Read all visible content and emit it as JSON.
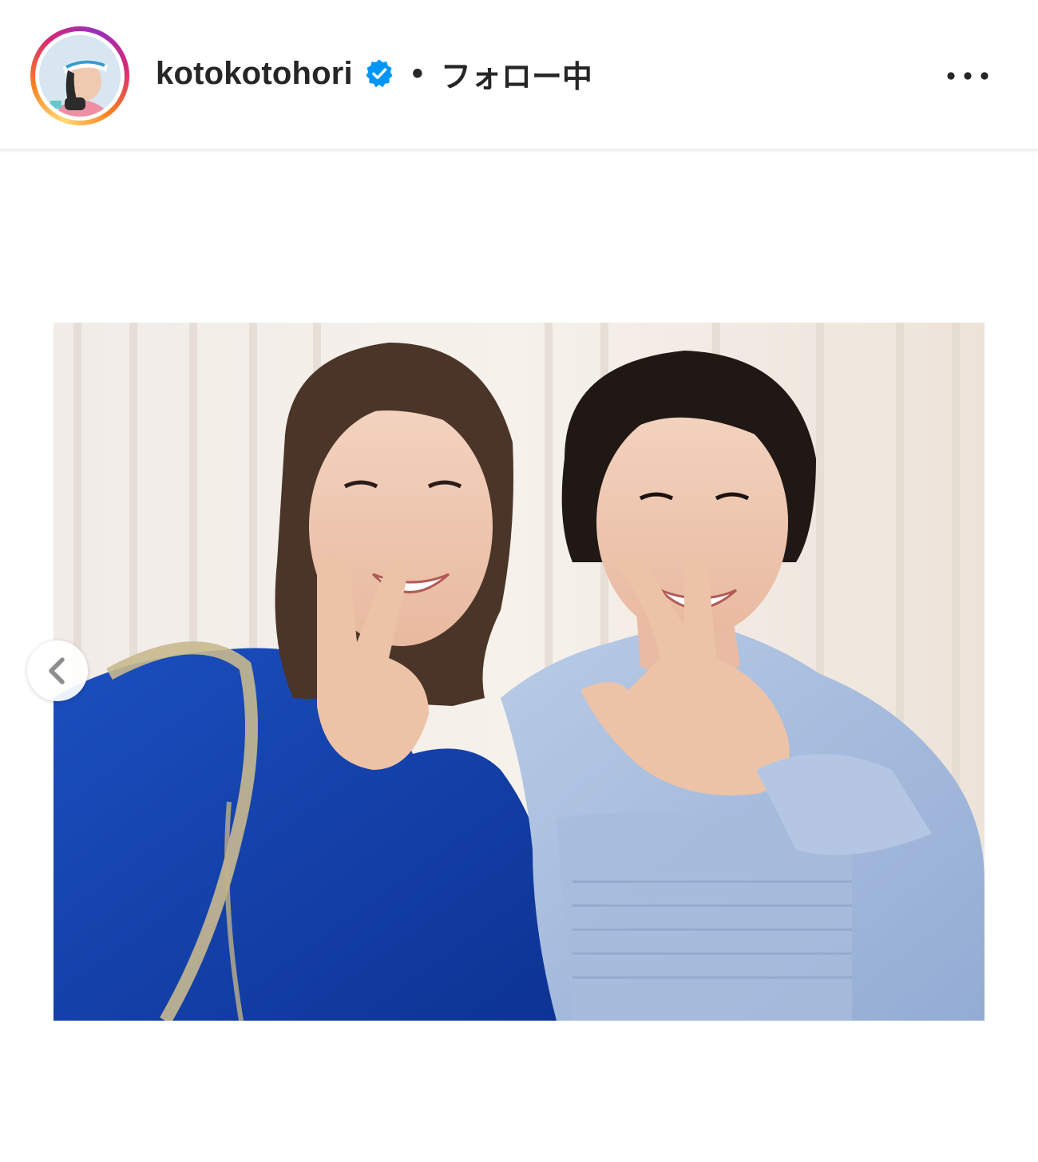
{
  "header": {
    "username": "kotokotohori",
    "separator": "•",
    "follow_status": "フォロー中",
    "verified_icon": "verified-badge-icon",
    "more_icon": "more-options-icon"
  },
  "post": {
    "nav": {
      "prev_icon": "chevron-left-icon"
    }
  },
  "colors": {
    "verified_blue": "#0095f6",
    "text": "#262626",
    "ring_start": "#feda75",
    "ring_mid": "#d62976",
    "ring_end": "#962fbf"
  }
}
